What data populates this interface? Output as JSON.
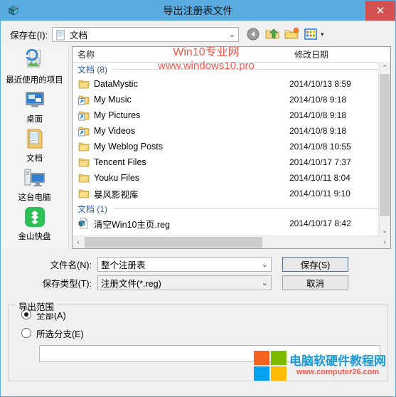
{
  "window": {
    "title": "导出注册表文件",
    "icon": "regedit-icon",
    "close_label": "✕",
    "titlebar_color": "#5aace0",
    "close_color": "#d25050"
  },
  "savein": {
    "label": "保存在(I):",
    "value": "文档",
    "arrow": "⌄",
    "toolbar": [
      {
        "name": "back-button",
        "label": "后退"
      },
      {
        "name": "up-folder-button",
        "label": "向上一级"
      },
      {
        "name": "new-folder-button",
        "label": "新建文件夹"
      },
      {
        "name": "views-button",
        "label": "视图"
      }
    ],
    "views_caret": "▾"
  },
  "places": [
    {
      "label": "最近使用的项目",
      "icon": "recent-items-icon"
    },
    {
      "label": "桌面",
      "icon": "desktop-icon"
    },
    {
      "label": "文档",
      "icon": "documents-icon"
    },
    {
      "label": "这台电脑",
      "icon": "this-pc-icon"
    },
    {
      "label": "金山快盘",
      "icon": "kuaipan-icon"
    }
  ],
  "filelist": {
    "columns": {
      "name": "名称",
      "date": "修改日期"
    },
    "sort_marker": "⌃",
    "groups": [
      {
        "label": "文档 (8)",
        "items": [
          {
            "name": "DataMystic",
            "date": "2014/10/13 8:59",
            "icon": "folder-icon"
          },
          {
            "name": "My Music",
            "date": "2014/10/8 9:18",
            "icon": "folder-shortcut-icon"
          },
          {
            "name": "My Pictures",
            "date": "2014/10/8 9:18",
            "icon": "folder-shortcut-icon"
          },
          {
            "name": "My Videos",
            "date": "2014/10/8 9:18",
            "icon": "folder-shortcut-icon"
          },
          {
            "name": "My Weblog Posts",
            "date": "2014/10/8 10:55",
            "icon": "folder-icon"
          },
          {
            "name": "Tencent Files",
            "date": "2014/10/17 7:37",
            "icon": "folder-icon"
          },
          {
            "name": "Youku Files",
            "date": "2014/10/11 8:04",
            "icon": "folder-icon"
          },
          {
            "name": "暴风影视库",
            "date": "2014/10/11 9:10",
            "icon": "folder-icon"
          }
        ]
      },
      {
        "label": "文档 (1)",
        "items": [
          {
            "name": "清空Win10主页.reg",
            "date": "2014/10/17 8:42",
            "icon": "reg-file-icon"
          }
        ]
      }
    ],
    "scroll": {
      "up": "⌃",
      "down": "⌄",
      "left": "‹",
      "right": "›"
    }
  },
  "watermark": {
    "line1": "Win10专业网",
    "line2": "www.windows10.pro",
    "color": "#f4584f"
  },
  "form": {
    "filename_label": "文件名(N):",
    "filename_value": "整个注册表",
    "filetype_label": "保存类型(T):",
    "filetype_value": "注册文件(*.reg)",
    "arrow": "⌄",
    "save_label": "保存(S)",
    "cancel_label": "取消"
  },
  "export_range": {
    "title": "导出范围",
    "options": [
      {
        "label": "全部(A)",
        "selected": true
      },
      {
        "label": "所选分支(E)",
        "selected": false
      }
    ],
    "branch_value": ""
  },
  "footer_logo": {
    "text_cn": "电脑软硬件教程网",
    "text_url": "www.computer26.com",
    "colors": [
      "#f4621f",
      "#7cbb00",
      "#00a1f1",
      "#ffbb00"
    ]
  }
}
